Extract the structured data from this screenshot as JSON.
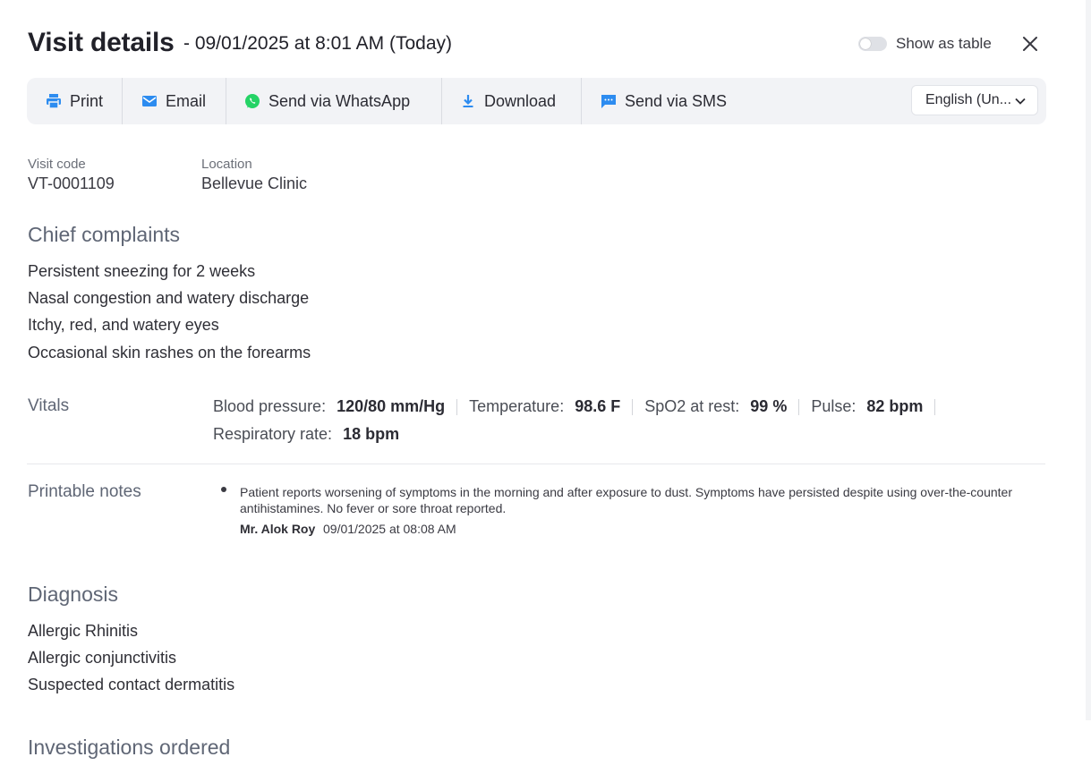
{
  "header": {
    "title": "Visit details",
    "subtitle": "- 09/01/2025 at 8:01 AM (Today)",
    "toggle_label": "Show as table"
  },
  "toolbar": {
    "print": "Print",
    "email": "Email",
    "whatsapp": "Send via WhatsApp",
    "download": "Download",
    "sms": "Send via SMS",
    "language": "English (Un..."
  },
  "meta": {
    "visit_code_label": "Visit code",
    "visit_code": "VT-0001109",
    "location_label": "Location",
    "location": "Bellevue Clinic"
  },
  "chief_complaints": {
    "title": "Chief complaints",
    "items": [
      "Persistent sneezing for 2 weeks",
      "Nasal congestion and watery discharge",
      "Itchy, red, and watery eyes",
      "Occasional skin rashes on the forearms"
    ]
  },
  "vitals": {
    "title": "Vitals",
    "items": [
      {
        "label": "Blood pressure:",
        "value": "120/80 mm/Hg"
      },
      {
        "label": "Temperature:",
        "value": "98.6 F"
      },
      {
        "label": "SpO2 at rest:",
        "value": "99 %"
      },
      {
        "label": "Pulse:",
        "value": "82 bpm"
      },
      {
        "label": "Respiratory rate:",
        "value": "18 bpm"
      }
    ]
  },
  "printable_notes": {
    "title": "Printable notes",
    "text": "Patient reports worsening of symptoms in the morning and after exposure to dust. Symptoms have persisted despite using over-the-counter antihistamines. No fever or sore throat reported.",
    "author": "Mr. Alok Roy",
    "timestamp": "09/01/2025 at 08:08 AM"
  },
  "diagnosis": {
    "title": "Diagnosis",
    "items": [
      "Allergic Rhinitis",
      "Allergic conjunctivitis",
      "Suspected contact dermatitis"
    ]
  },
  "investigations": {
    "title": "Investigations ordered"
  },
  "colors": {
    "accent_blue": "#2d8cf0",
    "whatsapp_green": "#25d366",
    "section_title": "#5f6675"
  }
}
